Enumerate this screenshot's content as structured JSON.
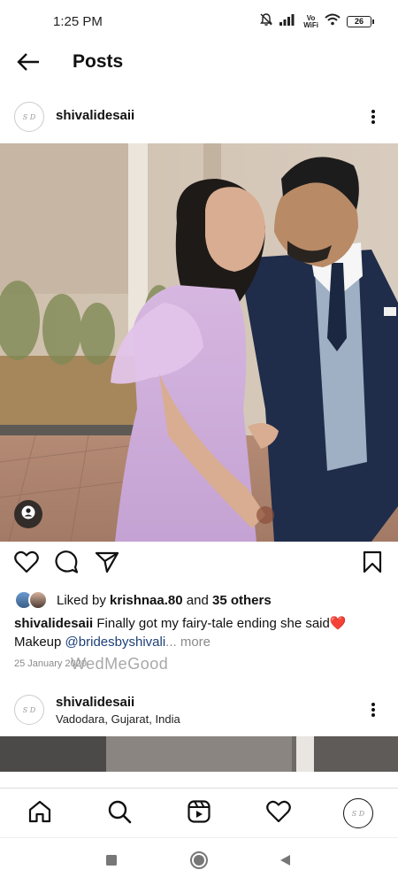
{
  "status_bar": {
    "time": "1:25 PM",
    "volte_line1": "Vo",
    "volte_line2": "WiFi",
    "battery": "26",
    "icons": [
      "mute-icon",
      "signal-icon",
      "wifi-icon",
      "battery-icon"
    ]
  },
  "header": {
    "title": "Posts",
    "back_icon": "arrow-left-icon"
  },
  "post": {
    "avatar_initials": "S D",
    "username": "shivalidesaii",
    "liked_by_prefix": "Liked by ",
    "liked_by_user": "krishnaa.80",
    "liked_by_and": " and ",
    "liked_by_others": "35 others",
    "caption_user": "shivalidesaii",
    "caption_text": " Finally got my fairy-tale ending she said",
    "caption_emoji": "❤️",
    "caption_line2_prefix": "Makeup ",
    "caption_mention": "@bridesbyshivali",
    "caption_more": "... more",
    "date": "25 January 2020",
    "watermark": "WedMeGood",
    "actions": [
      "heart-icon",
      "comment-icon",
      "share-icon",
      "bookmark-icon"
    ]
  },
  "next_post": {
    "avatar_initials": "S D",
    "username": "shivalidesaii",
    "location": "Vadodara, Gujarat, India"
  },
  "bottom_nav": {
    "items": [
      "home-icon",
      "search-icon",
      "reels-icon",
      "activity-heart-icon",
      "profile-avatar"
    ],
    "avatar_initials": "S D"
  },
  "system_nav": {
    "items": [
      "recents-square-icon",
      "home-circle-icon",
      "back-triangle-icon"
    ]
  },
  "colors": {
    "mention": "#1c3f78",
    "muted": "#8a8a8a",
    "dress": "#c8a6d6",
    "suit": "#1f2d4a",
    "vest": "#9fb0c4",
    "heart": "#e0313b"
  }
}
